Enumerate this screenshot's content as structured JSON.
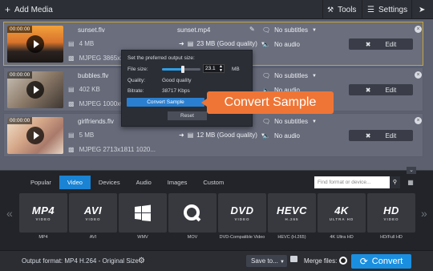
{
  "toolbar": {
    "add_media_label": "Add Media",
    "tools_label": "Tools",
    "settings_label": "Settings"
  },
  "files": [
    {
      "duration": "00:00:00",
      "name": "sunset.flv",
      "size": "4 MB",
      "codec": "MJPEG 3865x2",
      "output_name": "sunset.mp4",
      "output_size": "23 MB (Good quality)",
      "subtitles": "No subtitles",
      "audio": "No audio",
      "edit_label": "Edit"
    },
    {
      "duration": "00:00:00",
      "name": "bubbles.flv",
      "size": "402 KB",
      "codec": "MJPEG 1000x667",
      "output_name": "",
      "output_size": "",
      "subtitles": "No subtitles",
      "audio": "No audio",
      "edit_label": "Edit"
    },
    {
      "duration": "00:00:00",
      "name": "girlfriends.flv",
      "size": "5 MB",
      "codec": "MJPEG 2713x1811 1020...",
      "output_name": "",
      "output_size": "12 MB (Good quality)",
      "subtitles": "No subtitles",
      "audio": "No audio",
      "edit_label": "Edit"
    }
  ],
  "popup": {
    "title": "Set the preferred output size:",
    "file_size_label": "File size:",
    "file_size_value": "23.1",
    "file_size_unit": "MB",
    "slider_level": 0.55,
    "quality_label": "Quality:",
    "quality_value": "Good quality",
    "bitrate_label": "Bitrate:",
    "bitrate_value": "38717 Kbps",
    "convert_sample_label": "Convert Sample",
    "reset_label": "Reset"
  },
  "callout": "Convert Sample",
  "tabs": [
    {
      "label": "Popular",
      "active": false
    },
    {
      "label": "Video",
      "active": true
    },
    {
      "label": "Devices",
      "active": false
    },
    {
      "label": "Audio",
      "active": false
    },
    {
      "label": "Images",
      "active": false
    },
    {
      "label": "Custom",
      "active": false
    }
  ],
  "search_placeholder": "Find format or device...",
  "formats": [
    {
      "big": "MP4",
      "sub": "VIDEO",
      "caption": "MP4"
    },
    {
      "big": "AVI",
      "sub": "VIDEO",
      "caption": "AVI"
    },
    {
      "big": "",
      "sub": "",
      "caption": "WMV",
      "icon": "windows-logo-icon"
    },
    {
      "big": "",
      "sub": "",
      "caption": "MOV",
      "icon": "quicktime-logo-icon"
    },
    {
      "big": "DVD",
      "sub": "VIDEO",
      "caption": "DVD-Compatible Video"
    },
    {
      "big": "HEVC",
      "sub": "H.265",
      "caption": "HEVC (H.265)"
    },
    {
      "big": "4K",
      "sub": "ULTRA HD",
      "caption": "4K Ultra HD"
    },
    {
      "big": "HD",
      "sub": "VIDEO",
      "caption": "HD/Full HD"
    }
  ],
  "footer": {
    "output_format": "Output format: MP4 H.264 - Original Size",
    "save_to_label": "Save to...",
    "merge_label": "Merge files:",
    "convert_label": "Convert"
  },
  "colors": {
    "accent": "#1a83d3",
    "callout": "#ef7536",
    "selected_border": "#c7a43a"
  }
}
